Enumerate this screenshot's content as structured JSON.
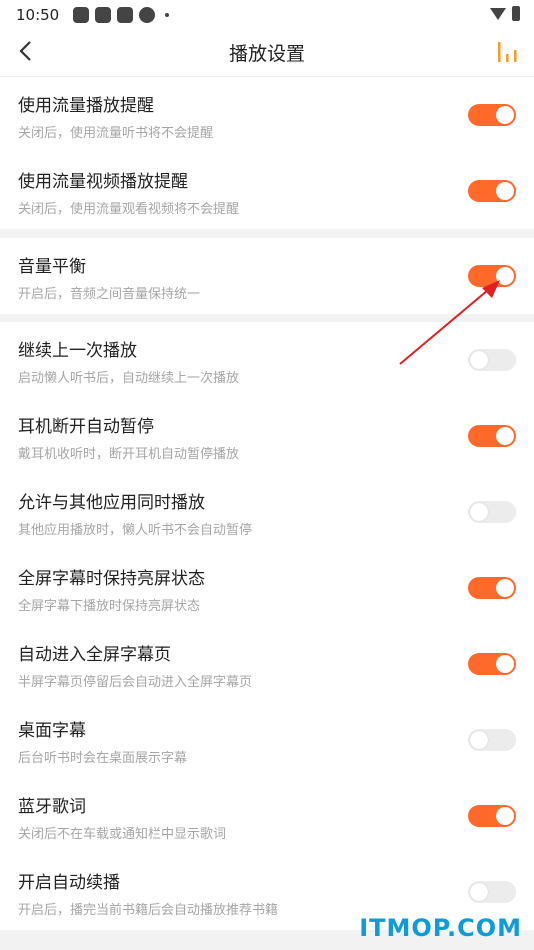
{
  "status": {
    "time": "10:50",
    "icons": [
      "app-icon",
      "app-icon",
      "app-icon",
      "ball-icon"
    ],
    "wifi": "wifi-icon",
    "battery": "battery-icon"
  },
  "header": {
    "title": "播放设置",
    "back_icon": "chevron-left-icon",
    "bars_icon": "bars-icon",
    "accent": "#ff9a1f"
  },
  "accent": "#ff6a2b",
  "groups": [
    [
      {
        "title": "使用流量播放提醒",
        "subtitle": "关闭后，使用流量听书将不会提醒",
        "on": true
      },
      {
        "title": "使用流量视频播放提醒",
        "subtitle": "关闭后，使用流量观看视频将不会提醒",
        "on": true
      }
    ],
    [
      {
        "title": "音量平衡",
        "subtitle": "开启后，音频之间音量保持统一",
        "on": true
      }
    ],
    [
      {
        "title": "继续上一次播放",
        "subtitle": "启动懒人听书后，自动继续上一次播放",
        "on": false
      },
      {
        "title": "耳机断开自动暂停",
        "subtitle": "戴耳机收听时，断开耳机自动暂停播放",
        "on": true
      },
      {
        "title": "允许与其他应用同时播放",
        "subtitle": "其他应用播放时，懒人听书不会自动暂停",
        "on": false
      },
      {
        "title": "全屏字幕时保持亮屏状态",
        "subtitle": "全屏字幕下播放时保持亮屏状态",
        "on": true
      },
      {
        "title": "自动进入全屏字幕页",
        "subtitle": "半屏字幕页停留后会自动进入全屏字幕页",
        "on": true
      },
      {
        "title": "桌面字幕",
        "subtitle": "后台听书时会在桌面展示字幕",
        "on": false
      },
      {
        "title": "蓝牙歌词",
        "subtitle": "关闭后不在车载或通知栏中显示歌词",
        "on": true
      },
      {
        "title": "开启自动续播",
        "subtitle": "开启后，播完当前书籍后会自动播放推荐书籍",
        "on": false
      }
    ]
  ],
  "watermark": "ITMOP.COM"
}
